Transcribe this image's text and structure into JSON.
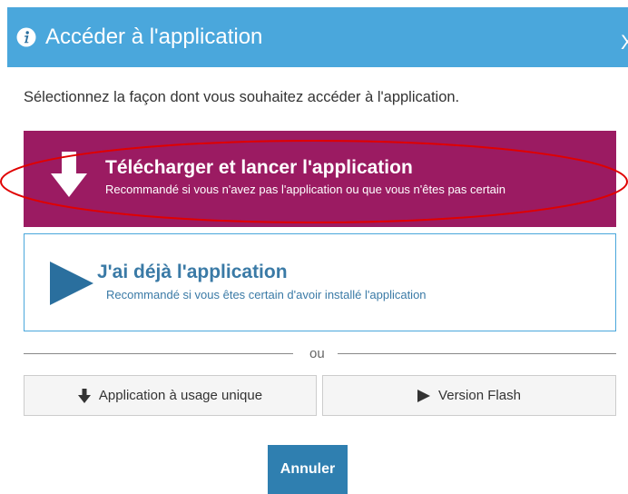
{
  "dialog": {
    "title": "Accéder à l'application",
    "close_label": "X",
    "instruction": "Sélectionnez la façon dont vous souhaitez accéder à l'application."
  },
  "options": {
    "download": {
      "title": "Télécharger et lancer l'application",
      "subtitle": "Recommandé si vous n'avez pas l'application ou que vous n'êtes pas certain",
      "icon": "download-arrow-icon"
    },
    "installed": {
      "title": "J'ai déjà l'application",
      "subtitle": "Recommandé si vous êtes certain d'avoir installé l'application",
      "icon": "play-icon"
    }
  },
  "separator": {
    "label": "ou"
  },
  "secondary_buttons": {
    "single_use": {
      "label": "Application à usage unique",
      "icon": "download-icon"
    },
    "flash": {
      "label": "Version Flash",
      "icon": "play-icon"
    }
  },
  "footer": {
    "cancel_label": "Annuler"
  },
  "colors": {
    "header_bg": "#4aa7dc",
    "download_bg": "#9b1b62",
    "installed_border": "#4aa7dc",
    "installed_text": "#3a7aa6",
    "cancel_bg": "#2f7fb0",
    "highlight_ellipse": "#e00000"
  }
}
